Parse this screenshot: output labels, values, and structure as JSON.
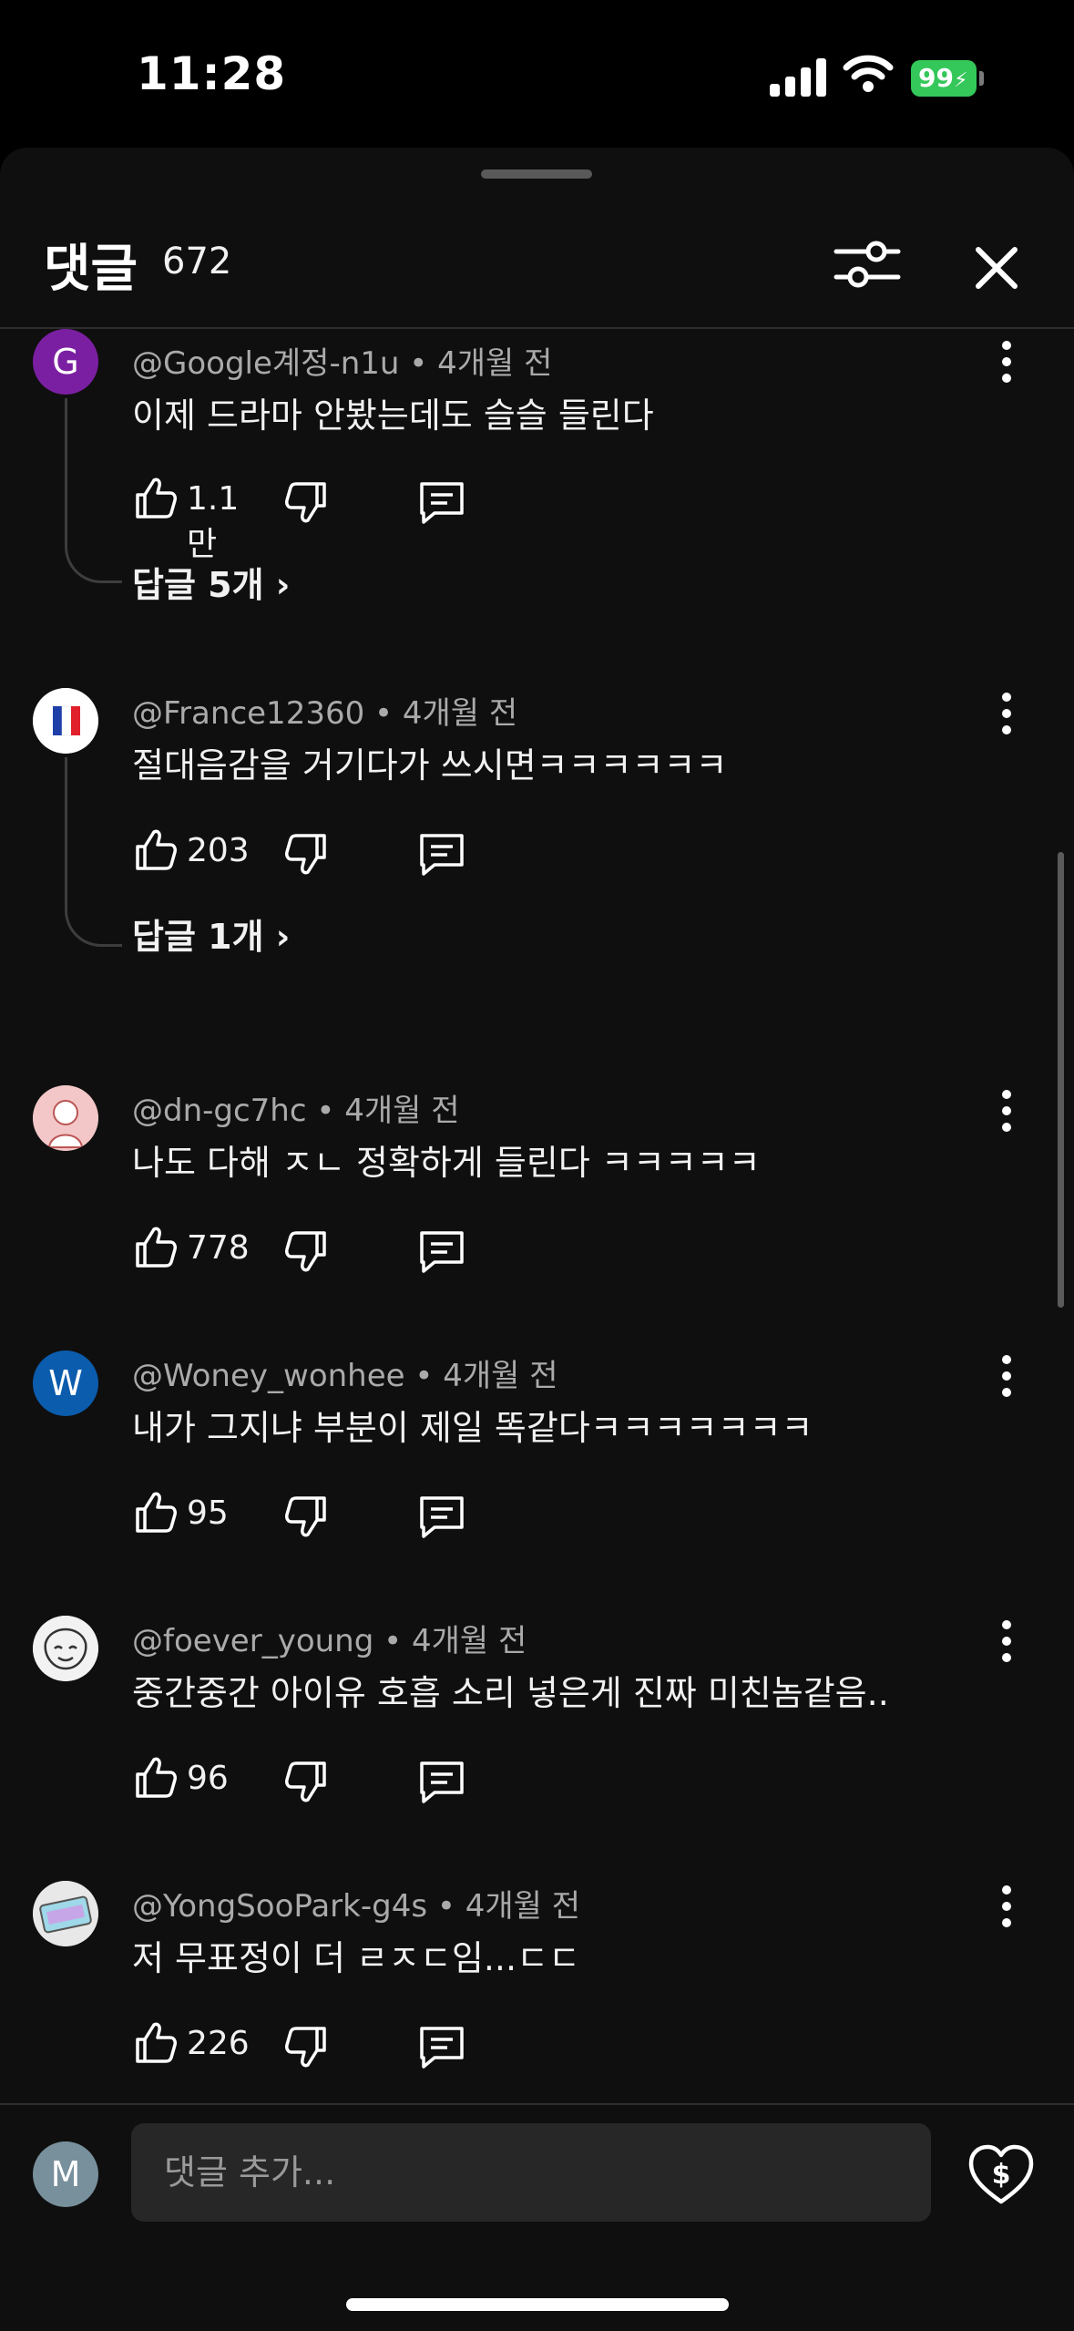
{
  "status_bar": {
    "time": "11:28",
    "battery": "99"
  },
  "header": {
    "title": "댓글",
    "count": "672"
  },
  "comments": [
    {
      "author": "@Google계정-n1u",
      "age": "4개월 전",
      "text": "이제 드라마 안봤는데도 슬슬 들린다",
      "likes": "1.1만",
      "avatar_letter": "G",
      "avatar_color": "#7b1fa2",
      "replies": "답글 5개"
    },
    {
      "author": "@France12360",
      "age": "4개월 전",
      "text": "절대음감을 거기다가 쓰시면ㅋㅋㅋㅋㅋㅋ",
      "likes": "203",
      "avatar_letter": "",
      "replies": "답글 1개"
    },
    {
      "author": "@dn-gc7hc",
      "age": "4개월 전",
      "text": "나도 다해 ㅈㄴ 정확하게 들린다 ㅋㅋㅋㅋㅋ",
      "likes": "778",
      "avatar_letter": ""
    },
    {
      "author": "@Woney_wonhee",
      "age": "4개월 전",
      "text": "내가 그지냐 부분이 제일 똑같다ㅋㅋㅋㅋㅋㅋㅋ",
      "likes": "95",
      "avatar_letter": "W",
      "avatar_color": "#0b5cad"
    },
    {
      "author": "@foever_young",
      "age": "4개월 전",
      "text": "중간중간 아이유 호흡 소리 넣은게 진짜 미친놈같음..",
      "likes": "96",
      "avatar_letter": ""
    },
    {
      "author": "@YongSooPark-g4s",
      "age": "4개월 전",
      "text": "저 무표정이 더 ㄹㅈㄷ임...ㄷㄷ",
      "likes": "226",
      "avatar_letter": ""
    }
  ],
  "composer": {
    "avatar_letter": "M",
    "placeholder": "댓글 추가..."
  },
  "icons": {
    "like": "thumbs-up-icon",
    "dislike": "thumbs-down-icon",
    "reply": "reply-icon",
    "more": "more-vert-icon",
    "filter": "filter-icon",
    "close": "close-icon",
    "thanks": "super-thanks-icon"
  },
  "colors": {
    "background": "#0f0f0f",
    "text": "#f1f1f1",
    "meta": "#aaaaaa",
    "battery": "#34c759"
  }
}
